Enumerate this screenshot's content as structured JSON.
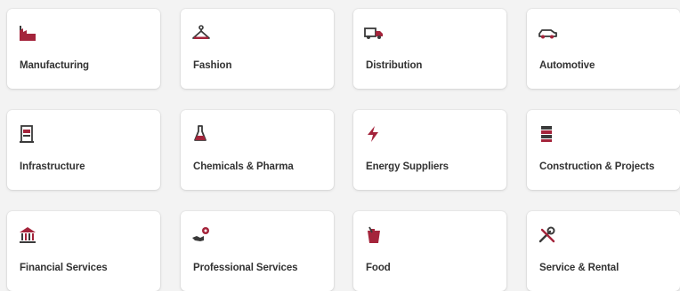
{
  "industries": [
    {
      "label": "Manufacturing",
      "icon": "factory-icon"
    },
    {
      "label": "Fashion",
      "icon": "clothes-hanger-icon"
    },
    {
      "label": "Distribution",
      "icon": "delivery-truck-icon"
    },
    {
      "label": "Automotive",
      "icon": "car-icon"
    },
    {
      "label": "Infrastructure",
      "icon": "building-infrastructure-icon"
    },
    {
      "label": "Chemicals & Pharma",
      "icon": "flask-icon"
    },
    {
      "label": "Energy Suppliers",
      "icon": "lightning-bolt-icon"
    },
    {
      "label": "Construction & Projects",
      "icon": "construction-stack-icon"
    },
    {
      "label": "Financial Services",
      "icon": "bank-icon"
    },
    {
      "label": "Professional Services",
      "icon": "handshake-gear-icon"
    },
    {
      "label": "Food",
      "icon": "food-basket-icon"
    },
    {
      "label": "Service & Rental",
      "icon": "tools-icon"
    }
  ],
  "colors": {
    "icon_accent": "#a4243b",
    "icon_dark": "#3a3a3a",
    "card_bg": "#ffffff",
    "page_bg": "#f3f3f3",
    "label_text": "#333333"
  }
}
